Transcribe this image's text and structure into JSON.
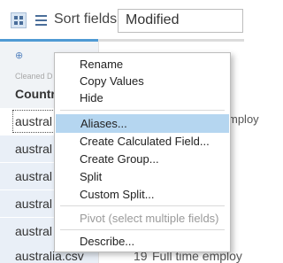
{
  "toolbar": {
    "grid_view_icon": "grid-icon",
    "list_view_icon": "list-icon",
    "sort_label": "Sort fields",
    "sort_value": "Modified"
  },
  "column": {
    "type_icon": "globe-icon",
    "subtitle": "Cleaned D",
    "name": "Countr"
  },
  "rows": [
    "austral",
    "austral",
    "austral",
    "austral",
    "austral"
  ],
  "bottom_row": {
    "name": "australia.csv",
    "number": "19",
    "text": "Full time employ"
  },
  "peek_text": {
    "row1": "...",
    "row2": "mploy"
  },
  "menu": {
    "items": [
      {
        "label": "Rename",
        "state": "normal"
      },
      {
        "label": "Copy Values",
        "state": "normal"
      },
      {
        "label": "Hide",
        "state": "normal"
      },
      {
        "label": "Aliases...",
        "state": "active"
      },
      {
        "label": "Create Calculated Field...",
        "state": "normal"
      },
      {
        "label": "Create Group...",
        "state": "normal"
      },
      {
        "label": "Split",
        "state": "normal"
      },
      {
        "label": "Custom Split...",
        "state": "normal"
      },
      {
        "label": "Pivot (select multiple fields)",
        "state": "disabled"
      },
      {
        "label": "Describe...",
        "state": "normal"
      }
    ]
  },
  "colors": {
    "accent_blue": "#4f9ad4",
    "row_bg": "#e9eff7",
    "menu_highlight": "#b5d6f0"
  }
}
